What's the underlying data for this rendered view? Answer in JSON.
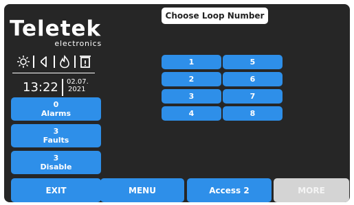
{
  "brand": {
    "name": "Teletek",
    "sub": "electronics"
  },
  "status_icons": [
    "sun-icon",
    "speaker-icon",
    "fire-icon",
    "door-icon"
  ],
  "clock": {
    "time": "13:22",
    "date_day_month": "02.07.",
    "date_year": "2021"
  },
  "side_buttons": [
    {
      "count": "0",
      "label": "Alarms"
    },
    {
      "count": "3",
      "label": "Faults"
    },
    {
      "count": "3",
      "label": "Disable"
    }
  ],
  "title": "Choose Loop Number",
  "loops": [
    "1",
    "2",
    "3",
    "4",
    "5",
    "6",
    "7",
    "8"
  ],
  "bottom_buttons": [
    {
      "label": "EXIT",
      "enabled": true
    },
    {
      "label": "MENU",
      "enabled": true
    },
    {
      "label": "Access 2",
      "enabled": true
    },
    {
      "label": "MORE",
      "enabled": false
    }
  ],
  "colors": {
    "panel": "#262626",
    "button": "#2e8fe9",
    "disabled": "#d4d4d4"
  }
}
